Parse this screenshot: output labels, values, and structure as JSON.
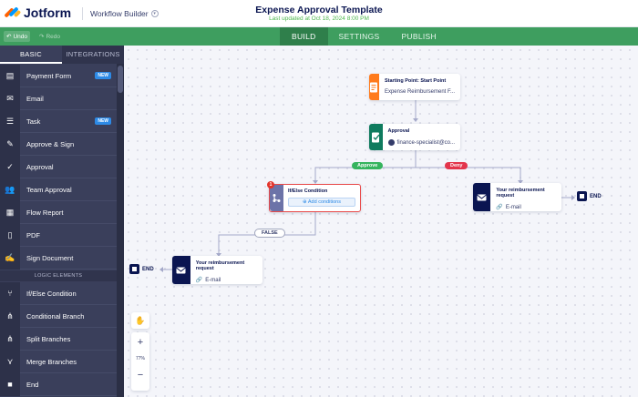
{
  "app": {
    "name": "Jotform",
    "builder": "Workflow Builder"
  },
  "header": {
    "title": "Expense Approval Template",
    "subtitle": "Last updated at Oct 18, 2024 8:00 PM"
  },
  "toolbar": {
    "undo": "Undo",
    "redo": "Redo",
    "tabs": [
      "BUILD",
      "SETTINGS",
      "PUBLISH"
    ],
    "active_tab": "BUILD"
  },
  "sidebar": {
    "tabs": [
      "BASIC",
      "INTEGRATIONS"
    ],
    "items": [
      {
        "label": "Payment Form",
        "badge": "NEW",
        "icon": "payment-form-icon"
      },
      {
        "label": "Email",
        "icon": "email-icon"
      },
      {
        "label": "Task",
        "badge": "NEW",
        "icon": "task-icon"
      },
      {
        "label": "Approve & Sign",
        "icon": "approve-sign-icon"
      },
      {
        "label": "Approval",
        "icon": "approval-icon"
      },
      {
        "label": "Team Approval",
        "icon": "team-approval-icon"
      },
      {
        "label": "Flow Report",
        "icon": "flow-report-icon"
      },
      {
        "label": "PDF",
        "icon": "pdf-icon"
      },
      {
        "label": "Sign Document",
        "icon": "sign-document-icon"
      }
    ],
    "section": "LOGIC ELEMENTS",
    "logic_items": [
      {
        "label": "If/Else Condition",
        "icon": "if-else-icon"
      },
      {
        "label": "Conditional Branch",
        "icon": "conditional-branch-icon"
      },
      {
        "label": "Split Branches",
        "icon": "split-branches-icon"
      },
      {
        "label": "Merge Branches",
        "icon": "merge-branches-icon"
      },
      {
        "label": "End",
        "icon": "end-icon"
      }
    ]
  },
  "canvas": {
    "start": {
      "title": "Starting Point: Start Point",
      "sub": "Expense Reimbursement F..."
    },
    "approval": {
      "title": "Approval",
      "sub": "finance-specialist@co..."
    },
    "approve_label": "Approve",
    "deny_label": "Deny",
    "ifelse": {
      "title": "If/Else Condition",
      "button": "Add conditions",
      "error_count": "1"
    },
    "false_label": "FALSE",
    "email_right": {
      "title": "Your reimbursement request",
      "sub": "E-mail"
    },
    "email_left": {
      "title": "Your reimbursement request",
      "sub": "E-mail"
    },
    "end_label": "END",
    "zoom_level": "77%"
  },
  "colors": {
    "green": "#3e9e5f",
    "navy": "#0a1551",
    "orange": "#ff7b1c",
    "teal": "#0f7b5e",
    "purple": "#6c73a8",
    "approve": "#35b45d",
    "deny": "#e3354b"
  }
}
